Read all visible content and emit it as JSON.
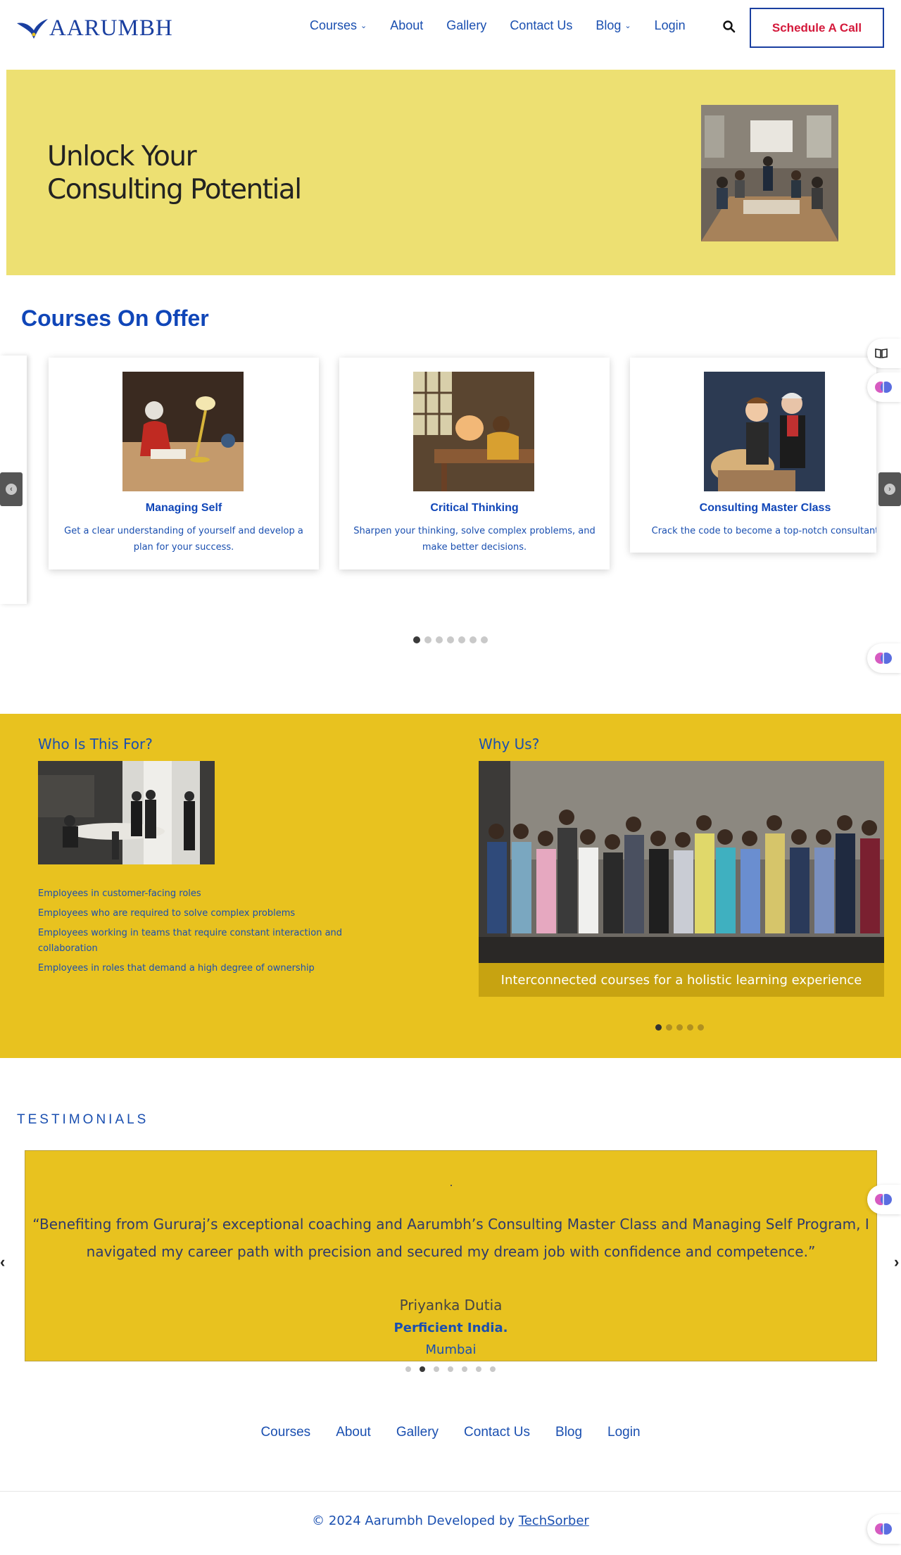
{
  "header": {
    "logo_text": "AARUMBH",
    "nav": [
      {
        "label": "Courses",
        "has_dropdown": true
      },
      {
        "label": "About",
        "has_dropdown": false
      },
      {
        "label": "Gallery",
        "has_dropdown": false
      },
      {
        "label": "Contact Us",
        "has_dropdown": false
      },
      {
        "label": "Blog",
        "has_dropdown": true
      },
      {
        "label": "Login",
        "has_dropdown": false
      }
    ],
    "cta_label": "Schedule A Call",
    "colors": {
      "brand": "#1a3fa0",
      "cta_text": "#d4193b"
    }
  },
  "hero": {
    "title_line1": "Unlock Your",
    "title_line2": "Consulting Potential",
    "background": "#ede072"
  },
  "courses": {
    "heading": "Courses On Offer",
    "cards": [
      {
        "title": "Managing Self",
        "description": "Get a clear understanding of yourself and develop a plan for your success."
      },
      {
        "title": "Critical Thinking",
        "description": "Sharpen your thinking, solve complex problems, and make better decisions."
      },
      {
        "title": "Consulting Master Class",
        "description": "Crack the code to become a top-notch consultant"
      }
    ],
    "slide_count": 7,
    "active_slide": 1
  },
  "who": {
    "heading": "Who Is This For?",
    "items": [
      "Employees in customer-facing roles",
      "Employees who are required to solve complex problems",
      "Employees working in teams that require constant interaction and collaboration",
      "Employees in roles that demand a high degree of ownership"
    ]
  },
  "why": {
    "heading": "Why Us?",
    "caption": "Interconnected courses for a holistic learning experience",
    "slide_count": 5,
    "active_slide": 1
  },
  "testimonials": {
    "heading": "TESTIMONIALS",
    "quote": "“Benefiting from Gururaj’s exceptional coaching and Aarumbh’s Consulting Master Class and Managing Self Program, I navigated my career path with precision and secured my dream job with confidence and competence.”",
    "name": "Priyanka Dutia",
    "company": "Perficient India.",
    "city": "Mumbai",
    "slide_count": 7,
    "active_slide": 2,
    "prev_glyph": "‹",
    "next_glyph": "›"
  },
  "footer": {
    "links": [
      "Courses",
      "About",
      "Gallery",
      "Contact Us",
      "Blog",
      "Login"
    ],
    "copyright_prefix": "© 2024 Aarumbh  Developed by",
    "developer": "TechSorber"
  }
}
